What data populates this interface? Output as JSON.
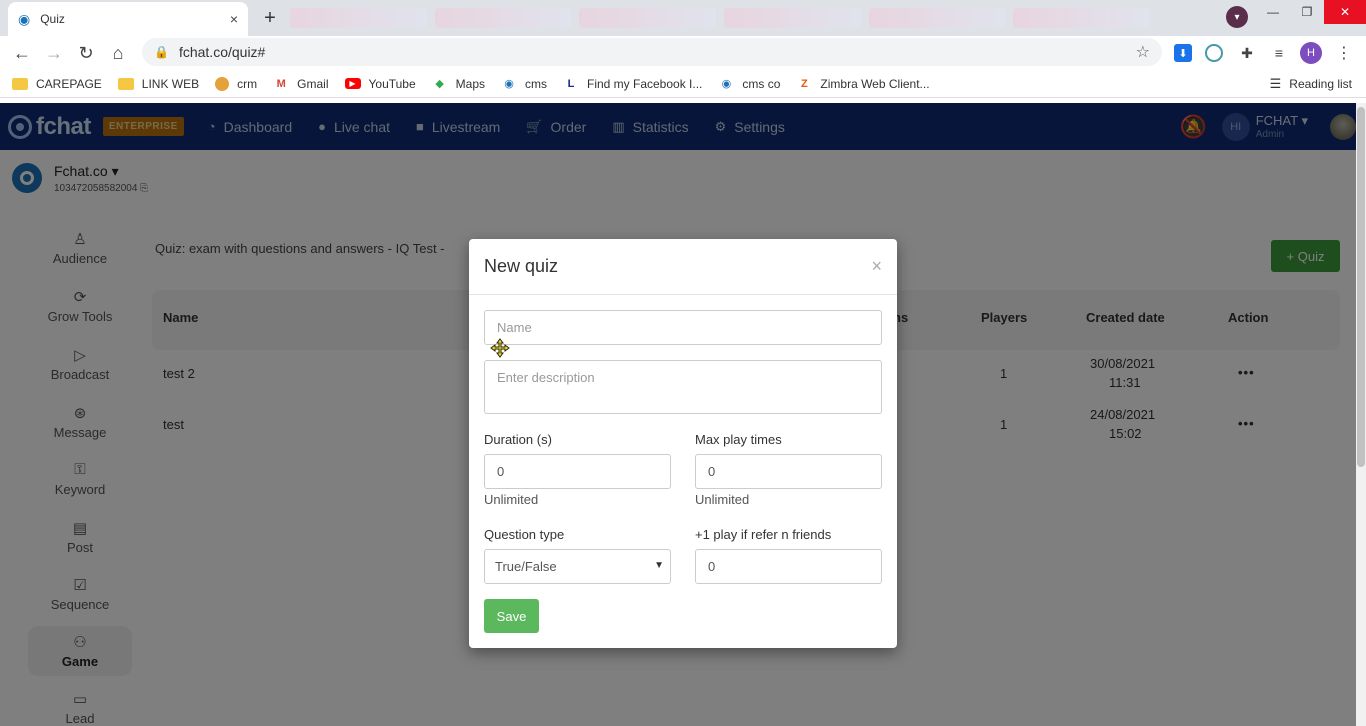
{
  "browser": {
    "tab_title": "Quiz",
    "tab_close": "×",
    "new_tab": "+",
    "url": "fchat.co/quiz#",
    "profile_initial": "H",
    "bookmarks": [
      {
        "label": "CAREPAGE",
        "icon": "folder"
      },
      {
        "label": "LINK WEB",
        "icon": "folder"
      },
      {
        "label": "crm",
        "icon": "crm"
      },
      {
        "label": "Gmail",
        "icon": "gmail"
      },
      {
        "label": "YouTube",
        "icon": "yt"
      },
      {
        "label": "Maps",
        "icon": "maps"
      },
      {
        "label": "cms",
        "icon": "fc"
      },
      {
        "label": "Find my Facebook I...",
        "icon": "L"
      },
      {
        "label": "cms co",
        "icon": "fc"
      },
      {
        "label": "Zimbra Web Client...",
        "icon": "zim"
      }
    ],
    "reading_list": "Reading list"
  },
  "app": {
    "brand": "fchat",
    "plan_badge": "ENTERPRISE",
    "nav": [
      {
        "label": "Dashboard",
        "icon": "dashboard-icon",
        "glyph": "◔"
      },
      {
        "label": "Live chat",
        "icon": "chat-bubble-icon",
        "glyph": "●"
      },
      {
        "label": "Livestream",
        "icon": "video-camera-icon",
        "glyph": "■"
      },
      {
        "label": "Order",
        "icon": "shopping-cart-icon",
        "glyph": "🛒"
      },
      {
        "label": "Statistics",
        "icon": "bar-chart-icon",
        "glyph": "▥"
      },
      {
        "label": "Settings",
        "icon": "settings-gear-icon",
        "glyph": "⚙"
      }
    ],
    "user": {
      "initials": "HI",
      "name": "FCHAT ▾",
      "role": "Admin"
    },
    "page": {
      "name": "Fchat.co ▾",
      "id": "103472058582004 ⎘"
    }
  },
  "sidebar": [
    {
      "label": "Audience",
      "icon": "audience-icon",
      "glyph": "♙"
    },
    {
      "label": "Grow Tools",
      "icon": "grow-tools-icon",
      "glyph": "⟳"
    },
    {
      "label": "Broadcast",
      "icon": "broadcast-icon",
      "glyph": "▷"
    },
    {
      "label": "Message",
      "icon": "message-icon",
      "glyph": "⊛"
    },
    {
      "label": "Keyword",
      "icon": "keyword-icon",
      "glyph": "⚿"
    },
    {
      "label": "Post",
      "icon": "post-icon",
      "glyph": "▤"
    },
    {
      "label": "Sequence",
      "icon": "sequence-icon",
      "glyph": "☑"
    },
    {
      "label": "Game",
      "icon": "gamepad-icon",
      "glyph": "⚇"
    },
    {
      "label": "Lead",
      "icon": "lead-icon",
      "glyph": "▭"
    }
  ],
  "content": {
    "breadcrumb": "Quiz: exam with questions and answers - IQ Test -",
    "add_button": "+ Quiz",
    "columns": [
      "Name",
      "ns",
      "Players",
      "Created date",
      "Action"
    ],
    "rows": [
      {
        "name": "test 2",
        "players": "1",
        "date": "30/08/2021",
        "time": "11:31",
        "action": "•••"
      },
      {
        "name": "test",
        "players": "1",
        "date": "24/08/2021",
        "time": "15:02",
        "action": "•••"
      }
    ]
  },
  "modal": {
    "title": "New quiz",
    "close": "×",
    "name_placeholder": "Name",
    "description_placeholder": "Enter description",
    "duration_label": "Duration (s)",
    "duration_value": "0",
    "duration_hint": "Unlimited",
    "max_play_label": "Max play times",
    "max_play_value": "0",
    "max_play_hint": "Unlimited",
    "question_type_label": "Question type",
    "question_type_value": "True/False",
    "refer_label": "+1 play if refer n friends",
    "refer_value": "0",
    "save_label": "Save"
  }
}
